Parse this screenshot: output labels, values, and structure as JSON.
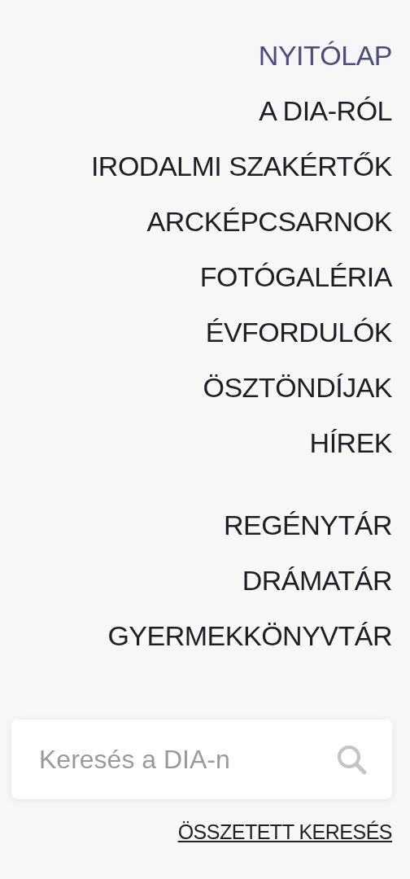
{
  "menu_groups": [
    {
      "items": [
        {
          "label": "NYITÓLAP",
          "selected": true
        },
        {
          "label": "A DIA-RÓL",
          "selected": false
        },
        {
          "label": "IRODALMI SZAKÉRTŐK",
          "selected": false
        },
        {
          "label": "ARCKÉPCSARNOK",
          "selected": false
        },
        {
          "label": "FOTÓGALÉRIA",
          "selected": false
        },
        {
          "label": "ÉVFORDULÓK",
          "selected": false
        },
        {
          "label": "ÖSZTÖNDÍJAK",
          "selected": false
        },
        {
          "label": "HÍREK",
          "selected": false
        }
      ]
    },
    {
      "items": [
        {
          "label": "REGÉNYTÁR",
          "selected": false
        },
        {
          "label": "DRÁMATÁR",
          "selected": false
        },
        {
          "label": "GYERMEKKÖNYVTÁR",
          "selected": false
        }
      ]
    }
  ],
  "search": {
    "placeholder": "Keresés a DIA-n"
  },
  "advanced_search_link": "ÖSSZETETT KERESÉS"
}
